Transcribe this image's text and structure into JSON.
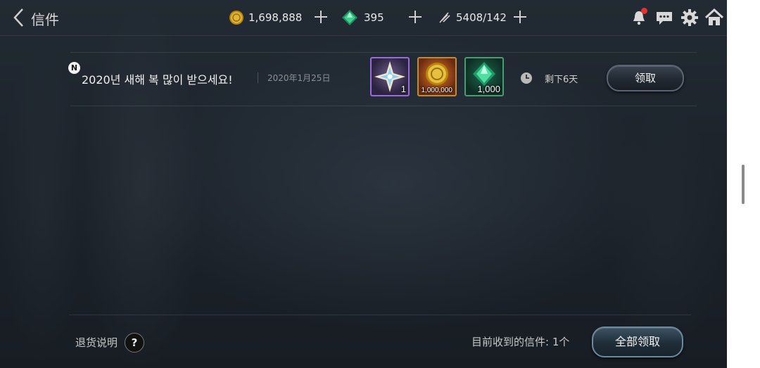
{
  "header": {
    "title": "信件",
    "gold": "1,698,888",
    "gems": "395",
    "stamina": "5408/142"
  },
  "mail": {
    "badge": "N",
    "title": "2020년 새해 복 많이 받으세요!",
    "date": "2020年1月25日",
    "rewards": [
      {
        "icon": "star-crystal-icon",
        "quantity": "1"
      },
      {
        "icon": "gold-coin-icon",
        "quantity": "1,000,000"
      },
      {
        "icon": "green-gem-icon",
        "quantity": "1,000"
      }
    ],
    "remaining": "剩下6天",
    "claim_label": "领取"
  },
  "footer": {
    "return_info": "退货说明",
    "help_label": "?",
    "mail_count": "目前收到的信件: 1个",
    "claim_all_label": "全部领取"
  },
  "colors": {
    "background": "#1d242c",
    "notification_dot": "#e23232",
    "gold": "#d4a623",
    "gem": "#2fbf82"
  }
}
